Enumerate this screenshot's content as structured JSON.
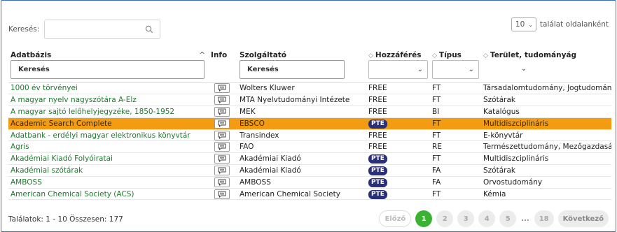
{
  "search": {
    "label": "Keresés:",
    "value": "",
    "icon": "search-icon"
  },
  "per_page": {
    "value": "10",
    "label": "találat oldalanként"
  },
  "columns": {
    "database": {
      "label": "Adatbázis",
      "sort": "^"
    },
    "info": {
      "label": "Info"
    },
    "provider": {
      "label": "Szolgáltató"
    },
    "access": {
      "label": "Hozzáférés",
      "sort": "◇"
    },
    "type": {
      "label": "Típus",
      "sort": "◇"
    },
    "field": {
      "label": "Terület, tudományág",
      "sort": "◇"
    }
  },
  "filters": {
    "database_placeholder": "Keresés",
    "provider_placeholder": "Keresés"
  },
  "rows": [
    {
      "database": "1000 év törvényei",
      "provider": "Wolters Kluwer",
      "access": "FREE",
      "type": "FT",
      "field": "Társadalomtudomány, Jogtudomány",
      "highlight": false
    },
    {
      "database": "A magyar nyelv nagyszótára A-Elz",
      "provider": "MTA Nyelvtudományi Intézete",
      "access": "FREE",
      "type": "FT",
      "field": "Szótárak",
      "highlight": false
    },
    {
      "database": "A magyar sajtó lelőhelyjegyzéke, 1850-1952",
      "provider": "MEK",
      "access": "FREE",
      "type": "BI",
      "field": "Katalógus",
      "highlight": false
    },
    {
      "database": "Academic Search Complete",
      "provider": "EBSCO",
      "access": "PTE",
      "type": "FT",
      "field": "Multidiszciplináris",
      "highlight": true
    },
    {
      "database": "Adatbank - erdélyi magyar elektronikus könyvtár",
      "provider": "Transindex",
      "access": "FREE",
      "type": "FT",
      "field": "E-könyvtár",
      "highlight": false
    },
    {
      "database": "Agris",
      "provider": "FAO",
      "access": "FREE",
      "type": "RE",
      "field": "Természettudomány, Mezőgazdaság",
      "highlight": false
    },
    {
      "database": "Akadémiai Kiadó Folyóiratai",
      "provider": "Akadémiai Kiadó",
      "access": "PTE",
      "type": "FT",
      "field": "Multidiszciplináris",
      "highlight": false
    },
    {
      "database": "Akadémiai szótárak",
      "provider": "Akadémiai Kiadó",
      "access": "PTE",
      "type": "FA",
      "field": "Szótárak",
      "highlight": false
    },
    {
      "database": "AMBOSS",
      "provider": "AMBOSS",
      "access": "PTE",
      "type": "FA",
      "field": "Orvostudomány",
      "highlight": false
    },
    {
      "database": "American Chemical Society (ACS)",
      "provider": "American Chemical Society",
      "access": "PTE",
      "type": "FT",
      "field": "Kémia",
      "highlight": false
    }
  ],
  "footer": {
    "summary": "Találatok: 1 - 10 Összesen: 177"
  },
  "pager": {
    "prev": "Előző",
    "pages": [
      "1",
      "2",
      "3",
      "4",
      "5"
    ],
    "ellipsis": "...",
    "last": "18",
    "next": "Következő",
    "active": "1"
  },
  "colors": {
    "link": "#1e7a2e",
    "highlight": "#f39c12",
    "badge": "#2a2f7a",
    "active_page": "#3bb233",
    "frame": "#3c6dbe"
  }
}
